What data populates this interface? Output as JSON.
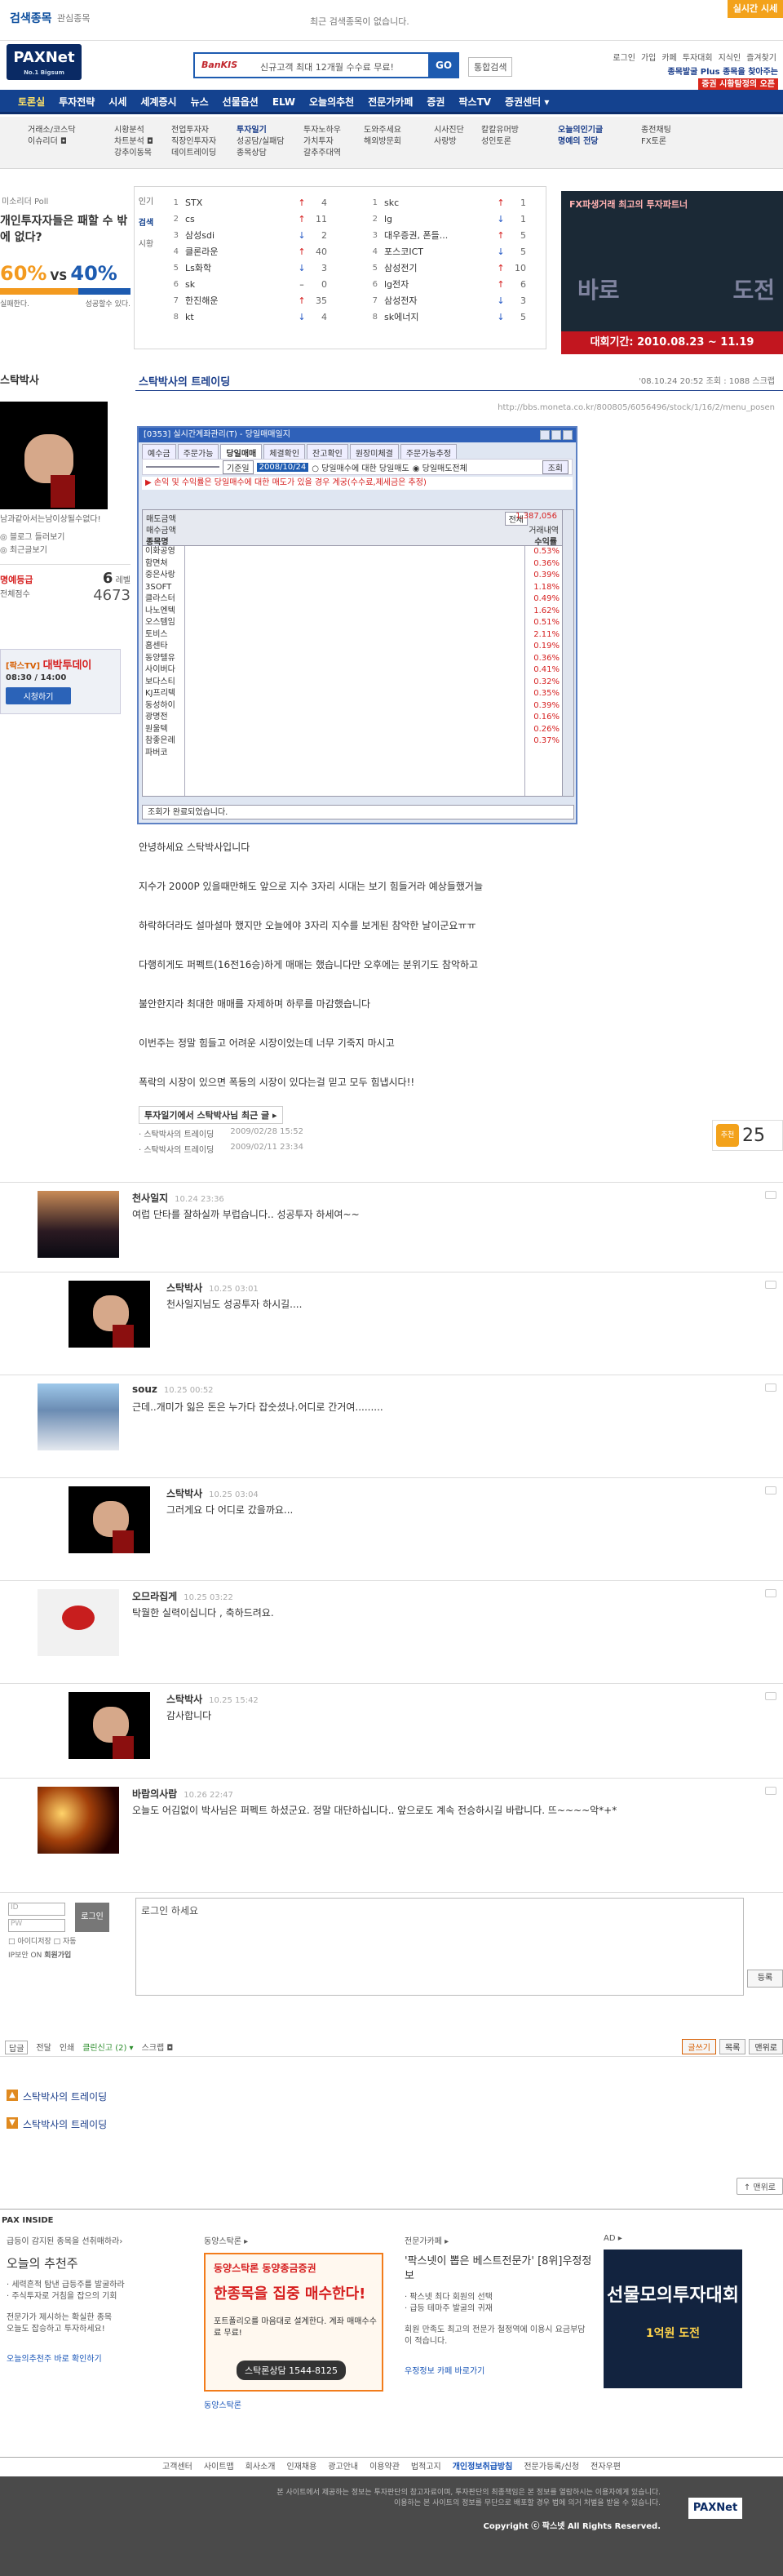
{
  "topbar": {
    "recent_title": "검색종목",
    "recent_sub": "관심종목",
    "recent_msg": "최근 검색종목이 없습니다.",
    "realtime": "실시간 시세"
  },
  "header": {
    "logo": "PAXNet",
    "logo_tag": "No.1 Bigsum",
    "search_brand": "BanKIS",
    "search_msg": "신규고객 최대 12개월 수수료 무료!",
    "search_go": "GO",
    "search_all": "통합검색",
    "util_links": [
      "로그인",
      "가입",
      "카페",
      "투자대회",
      "지식인",
      "즐겨찾기"
    ],
    "promo_line1": "종목발굴 Plus 종목을 찾아주는",
    "promo_line2": "증권 시황탐정의 오픈"
  },
  "gnb": [
    "토론실",
    "투자전략",
    "시세",
    "세계증시",
    "뉴스",
    "선물옵션",
    "ELW",
    "오늘의추천",
    "전문가카페",
    "증권",
    "팍스TV",
    "증권센터 ▾"
  ],
  "lnb": [
    [
      "거래소/코스닥",
      "이슈리더 ◘"
    ],
    [
      "시황분석",
      "차트분석 ◘",
      "강추이동목"
    ],
    [
      "전업투자자",
      "직장인투자자",
      "데이트레이딩"
    ],
    [
      "투자일기",
      "성공담/실패담",
      "종목상담"
    ],
    [
      "투자노하우",
      "가치투자",
      "갈추주대역"
    ],
    [
      "도와주세요",
      "해외방문회"
    ],
    [
      "시사진단",
      "사랑방"
    ],
    [
      "칼칼유머방",
      "성인토론"
    ],
    [
      "오늘의인기글",
      "명예의 전당"
    ],
    [
      "종전채팅",
      "FX토론"
    ]
  ],
  "poll": {
    "label": "미소리더 Poll",
    "question": "개인투자자들은 패할 수 밖에 없다?",
    "pct_a": "60%",
    "vs": "VS",
    "pct_b": "40%",
    "share_a": 0.6,
    "legend_a": "실패한다.",
    "legend_b": "성공할수 있다."
  },
  "popular": {
    "tabs": [
      "인기",
      "검색",
      "시황"
    ],
    "left": [
      {
        "rank": "1",
        "name": "STX",
        "dir": "up",
        "change": "4"
      },
      {
        "rank": "2",
        "name": "cs",
        "dir": "up",
        "change": "11"
      },
      {
        "rank": "3",
        "name": "삼성sdi",
        "dir": "dn",
        "change": "2"
      },
      {
        "rank": "4",
        "name": "클론라운",
        "dir": "up",
        "change": "40"
      },
      {
        "rank": "5",
        "name": "Ls화학",
        "dir": "dn",
        "change": "3"
      },
      {
        "rank": "6",
        "name": "sk",
        "dir": "",
        "change": "0"
      },
      {
        "rank": "7",
        "name": "한진해운",
        "dir": "up",
        "change": "35"
      },
      {
        "rank": "8",
        "name": "kt",
        "dir": "dn",
        "change": "4"
      }
    ],
    "right": [
      {
        "rank": "1",
        "name": "skc",
        "dir": "up",
        "change": "1"
      },
      {
        "rank": "2",
        "name": "lg",
        "dir": "dn",
        "change": "1"
      },
      {
        "rank": "3",
        "name": "대우증권, 폰들...",
        "dir": "up",
        "change": "5"
      },
      {
        "rank": "4",
        "name": "포스코ICT",
        "dir": "dn",
        "change": "5"
      },
      {
        "rank": "5",
        "name": "삼성전기",
        "dir": "up",
        "change": "10"
      },
      {
        "rank": "6",
        "name": "lg전자",
        "dir": "up",
        "change": "6"
      },
      {
        "rank": "7",
        "name": "삼성전자",
        "dir": "dn",
        "change": "3"
      },
      {
        "rank": "8",
        "name": "sk에너지",
        "dir": "dn",
        "change": "5"
      }
    ]
  },
  "fx_banner": {
    "title": "FX파생거래 최고의 투자파트너",
    "left_word": "바로",
    "right_word": "도전",
    "dates": "대회기간: 2010.08.23 ~ 11.19"
  },
  "profile": {
    "name": "스탁박사",
    "intro": "남과같아서는남이상될수없다!",
    "links": [
      "◎ 블로그 들러보기",
      "◎ 최근글보기"
    ],
    "grade_label": "명예등급",
    "grade": "6",
    "grade_unit": "레벨",
    "total_label": "전체점수",
    "total": "4673"
  },
  "tv_banner": {
    "brand": "[팍스TV]",
    "show": "대박투데이",
    "time": "08:30 / 14:00",
    "watch": "시청하기"
  },
  "post": {
    "title": "스탁박사의 트레이딩",
    "meta": "'08.10.24 20:52  조회 : 1088  스크랩",
    "url": "http://bbs.moneta.co.kr/800805/6056496/stock/1/16/2/menu_posen",
    "body": [
      "안녕하세요 스탁박사입니다",
      "지수가 2000P 있을때만해도 앞으로 지수 3자리 시대는 보기 힘들거라 예상들했거늘",
      "하락하더라도 설마설마 했지만 오늘에야 3자리 지수를 보게된 참악한 날이군요ㅠㅠ",
      "다행히게도 퍼펙트(16전16승)하게 매매는 했습니다만 오후에는 분위기도 참악하고",
      "불안한지라 최대한 매매를 자제하며 하루를 마감했습니다",
      "이번주는 정말 힘들고 어려운 시장이었는데 너무 기죽지 마시고",
      "폭락의 시장이 있으면 폭등의 시장이 있다는걸 믿고 모두 힘냅시다!!"
    ],
    "related_head": "투자일기에서 스탁박사님 최근 글 ▸",
    "related": [
      {
        "title": "· 스탁박사의 트레이딩",
        "date": "2009/02/28 15:52"
      },
      {
        "title": "· 스탁박사의 트레이딩",
        "date": "2009/02/11 23:34"
      }
    ],
    "recommend_label": "추천",
    "recommend": "25"
  },
  "window": {
    "title": "[0353] 실시간계좌관리(T) - 당일매매일지",
    "tabs": [
      "예수금",
      "주문가능",
      "당일매매",
      "체결확인",
      "잔고확인",
      "원장미체결",
      "주문가능추정"
    ],
    "filter_acct": "",
    "filter_label": "기준일",
    "filter_date": "2008/10/24",
    "opt1": "○ 당일매수에 대한 당일매도",
    "opt2": "◉ 당일매도전체",
    "btn": "조회",
    "notice": "▶ 손익 및 수익률은 당일매수에 대한 매도가 있을 경우 계궁(수수료,제세금은 추정)",
    "hdr1": "전체",
    "hdr2": "매도금액",
    "hdr3": "매수금액",
    "hdr4": "거래내역",
    "col_name": "종목명",
    "col_pct": "수익률",
    "total_right": "1,387,056",
    "names": [
      "이화공영",
      "함면쳐",
      "중은사랑",
      "3SOFT",
      "클라스터",
      "나노엔텍",
      "오스템임",
      "토비스",
      "홈센타",
      "동양텔유",
      "사이버다",
      "보다스티",
      "KJ프리텍",
      "동성하이",
      "광명전",
      "원울텍",
      "참좋은레",
      "파버코"
    ],
    "pcts": [
      "0.53%",
      "0.36%",
      "0.39%",
      "1.18%",
      "0.49%",
      "1.62%",
      "0.51%",
      "2.11%",
      "0.19%",
      "0.36%",
      "0.41%",
      "0.32%",
      "0.35%",
      "0.39%",
      "0.16%",
      "0.26%",
      "0.37%"
    ],
    "status": "조회가 완료되었습니다."
  },
  "comments": [
    {
      "who": "천사일지",
      "when": "10.24 23:36",
      "text": "여럽 단타를 잘하실까 부럽습니다.. 성공투자 하세여~~",
      "avatar": "city"
    },
    {
      "who": "스탁박사",
      "when": "10.25 03:01",
      "text": "천사일지님도 성공투자 하시길....",
      "avatar": "hand"
    },
    {
      "who": "souz",
      "when": "10.25 00:52",
      "text": "근데..개미가 잃은 돈은 누가다 잡숫셨나.어디로 간거여.........",
      "avatar": "building"
    },
    {
      "who": "스탁박사",
      "when": "10.25 03:04",
      "text": "그러게요 다 어디로 갔을까요...",
      "avatar": "hand"
    },
    {
      "who": "오므라집게",
      "when": "10.25 03:22",
      "text": "탁월한 실력이십니다 , 축하드려요.",
      "avatar": "crab"
    },
    {
      "who": "스탁박사",
      "when": "10.25 15:42",
      "text": "감사합니다",
      "avatar": "hand"
    },
    {
      "who": "바람의사람",
      "when": "10.26 22:47",
      "text": "오늘도 어김없이 박사님은 퍼펙트 하셨군요. 정말 대단하십니다.. 앞으로도 계속 전승하시길 바랍니다. 뜨~~~~악*+*",
      "avatar": "lights"
    }
  ],
  "login": {
    "id_placeholder": "ID",
    "pw_placeholder": "PW",
    "btn": "로그인",
    "opt1": "□ 아이디저장  □ 자동",
    "opt2": "IP보안 ON",
    "join": "회원가입",
    "textarea": "로그인 하세요",
    "register": "등록"
  },
  "actions": {
    "left": [
      "답글",
      "전달",
      "인쇄",
      "클린신고 (2) ▾",
      "스크랩 ◘"
    ],
    "right": [
      "글쓰기",
      "목록",
      "맨위로"
    ]
  },
  "nav": {
    "prev": "스탁박사의 트레이딩",
    "next": "스탁박사의 트레이딩",
    "to_top": "↑ 맨위로"
  },
  "inside": {
    "head": "PAX INSIDE",
    "col1_kicker": "급등이 감지된 종목을 선취매하라›",
    "col1_title": "오늘의 추천주",
    "col1_list": [
      "· 세력흔적 탐낸 급등주를 발굴하라",
      "· 주식투자로 거침을 잡으의 기회",
      "전문가가 제시하는 확실한 종목",
      "오늘도 잡승하고 투자하세요!"
    ],
    "col1_link": "오늘의추천주 바로 확인하기",
    "col2_kicker": "동양스탁론 ▸",
    "col2_ad_brand": "동양스탁론 동양종금증권",
    "col2_ad_main": "한종목을 집중 매수한다!",
    "col2_ad_sub": "포트폴리오를 마음대로 설계한다. 계좌 매매수수료 무료!",
    "col2_ad_tel": "스탁론상담 1544-8125",
    "col2_link": "동양스탁론",
    "col3_kicker": "전문가카페 ▸",
    "col3_title": "'팍스넷이 뽑은 베스트전문가' [8위]우정정보",
    "col3_list": [
      "· 팍스넷 최다 회원의 선택",
      "· 급등 테마주 발굴의 귀재"
    ],
    "col3_desc": "회원 만족도 최고의 전문가 철정역에 이용시 요금부담이 적습니다.",
    "col3_link": "우정정보 카페 바로가기",
    "col4_kicker": "AD ▸",
    "col4_ad_title": "선물모의투자대회",
    "col4_ad_sub": "1억원 도전"
  },
  "footer_links": [
    "고객센터",
    "사이트맵",
    "회사소개",
    "인재채용",
    "광고안내",
    "이용약관",
    "법적고지",
    "개인정보취급방침",
    "전문가등록/신청",
    "전자우편"
  ],
  "footer": {
    "line1": "본 사이트에서 제공하는 정보는 투자판단의 참고자료이며, 투자판단의 최종책임은 본 정보를 열람하시는 이용자에게 있습니다.",
    "line2": "이용하는 본 사이트의 정보를 무단으로 배포할 경우 법에 의거 처벌을 받을 수 있습니다.",
    "copy": "Copyright ⓒ 팍스넷 All Rights Reserved.",
    "logo": "PAXNet"
  }
}
